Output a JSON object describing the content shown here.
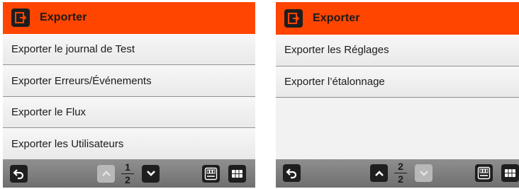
{
  "left_screen": {
    "title": "Exporter",
    "icon": "export-icon",
    "items": [
      {
        "label": "Exporter le journal de Test"
      },
      {
        "label": "Exporter Erreurs/Événements"
      },
      {
        "label": "Exporter le Flux"
      },
      {
        "label": "Exporter les Utilisateurs"
      }
    ],
    "page": {
      "current": "1",
      "total": "2"
    },
    "buttons": {
      "back": "back-icon",
      "page_up": "chevron-up-icon",
      "page_down": "chevron-down-icon",
      "clock": "clock-display-icon",
      "menu": "grid-menu-icon"
    },
    "page_up_enabled": false,
    "page_down_enabled": true
  },
  "right_screen": {
    "title": "Exporter",
    "icon": "export-icon",
    "items": [
      {
        "label": "Exporter les Réglages"
      },
      {
        "label": "Exporter l’étalonnage"
      }
    ],
    "page": {
      "current": "2",
      "total": "2"
    },
    "buttons": {
      "back": "back-icon",
      "page_up": "chevron-up-icon",
      "page_down": "chevron-down-icon",
      "clock": "clock-display-icon",
      "menu": "grid-menu-icon"
    },
    "page_up_enabled": true,
    "page_down_enabled": false
  },
  "colors": {
    "header": "#ff4500",
    "footer": "#7f7f7f",
    "button": "#1e1e1e",
    "button_disabled": "#b8b8b8"
  }
}
